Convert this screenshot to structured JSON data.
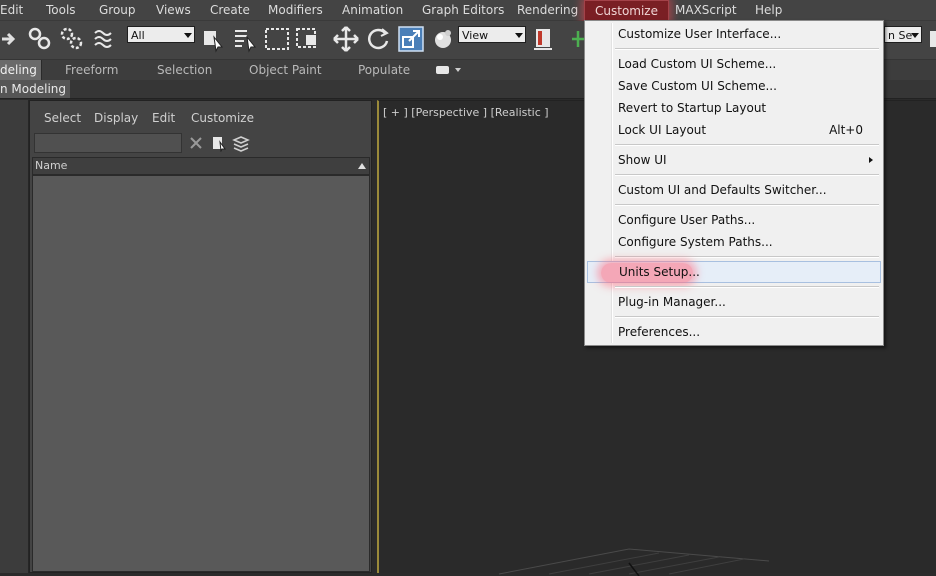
{
  "menubar": {
    "items": [
      "Edit",
      "Tools",
      "Group",
      "Views",
      "Create",
      "Modifiers",
      "Animation",
      "Graph Editors",
      "Rendering",
      "Customize",
      "MAXScript",
      "Help"
    ],
    "active": "Customize"
  },
  "toolbar": {
    "selection_filter": "All",
    "ref_coord": "View",
    "right_field": "n Se"
  },
  "ribbon": {
    "tabs": [
      "deling",
      "Freeform",
      "Selection",
      "Object Paint",
      "Populate"
    ],
    "sub_tab": "n Modeling"
  },
  "scene_explorer": {
    "menus": [
      "Select",
      "Display",
      "Edit",
      "Customize"
    ],
    "column_header": "Name"
  },
  "viewport": {
    "label": "[ + ] [Perspective ] [Realistic ]"
  },
  "customize_menu": {
    "items": [
      {
        "label": "Customize User Interface..."
      },
      {
        "label": "Load Custom UI Scheme..."
      },
      {
        "label": "Save Custom UI Scheme..."
      },
      {
        "label": "Revert to Startup Layout"
      },
      {
        "label": "Lock UI Layout",
        "shortcut": "Alt+0"
      },
      {
        "label": "Show UI"
      },
      {
        "label": "Custom UI and Defaults Switcher..."
      },
      {
        "label": "Configure User Paths..."
      },
      {
        "label": "Configure System Paths..."
      },
      {
        "label": "Units Setup..."
      },
      {
        "label": "Plug-in Manager..."
      },
      {
        "label": "Preferences..."
      }
    ],
    "highlighted": "Units Setup..."
  },
  "colors": {
    "ui_background": "#444444",
    "menu_highlight": "#7a1f24",
    "dropdown_bg": "#f0f0f0",
    "viewport_border": "#9a8a3a"
  }
}
